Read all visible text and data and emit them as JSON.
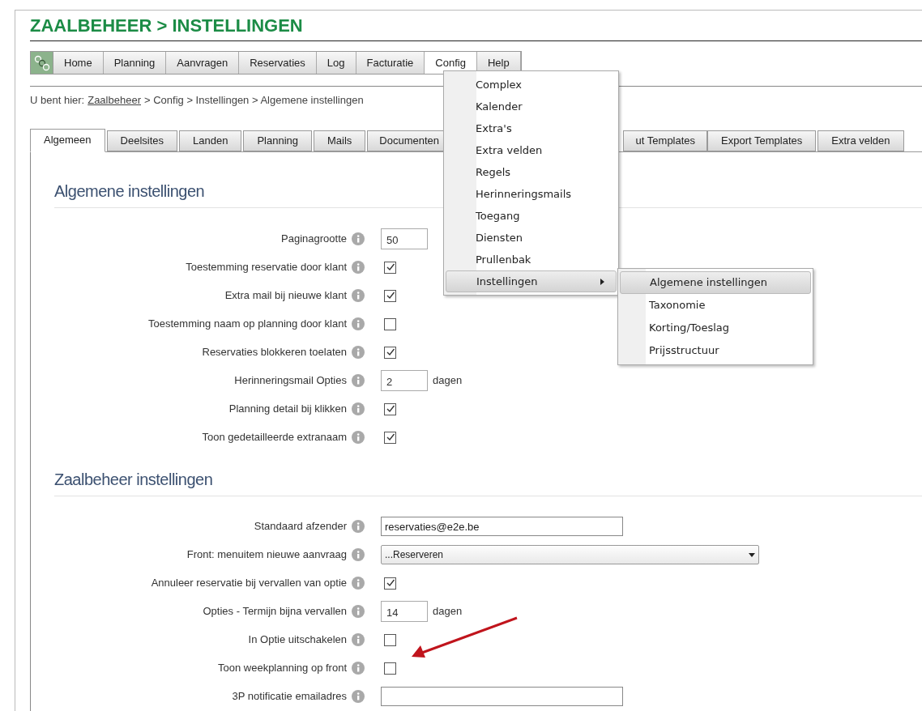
{
  "page_title": "ZAALBEHEER > INSTELLINGEN",
  "nav": {
    "items": [
      {
        "label": "Home",
        "selected": false
      },
      {
        "label": "Planning",
        "selected": false
      },
      {
        "label": "Aanvragen",
        "selected": false
      },
      {
        "label": "Reservaties",
        "selected": false
      },
      {
        "label": "Log",
        "selected": false
      },
      {
        "label": "Facturatie",
        "selected": false
      },
      {
        "label": "Config",
        "selected": true
      },
      {
        "label": "Help",
        "selected": false
      }
    ]
  },
  "breadcrumb": {
    "prefix": "U bent hier:",
    "link": "Zaalbeheer",
    "rest": "> Config > Instellingen > Algemene instellingen"
  },
  "tabs": [
    {
      "label": "Algemeen",
      "selected": true
    },
    {
      "label": "Deelsites",
      "selected": false
    },
    {
      "label": "Landen",
      "selected": false
    },
    {
      "label": "Planning",
      "selected": false
    },
    {
      "label": "Mails",
      "selected": false
    },
    {
      "label": "Documenten",
      "selected": false
    },
    {
      "label": "ut Templates",
      "selected": false
    },
    {
      "label": "Export Templates",
      "selected": false
    },
    {
      "label": "Extra velden",
      "selected": false
    }
  ],
  "sections": [
    {
      "title": "Algemene instellingen",
      "rows": [
        {
          "label": "Paginagrootte",
          "kind": "short",
          "value": "50"
        },
        {
          "label": "Toestemming reservatie door klant",
          "kind": "checkbox",
          "checked": true
        },
        {
          "label": "Extra mail bij nieuwe klant",
          "kind": "checkbox",
          "checked": true
        },
        {
          "label": "Toestemming naam op planning door klant",
          "kind": "checkbox",
          "checked": false
        },
        {
          "label": "Reservaties blokkeren toelaten",
          "kind": "checkbox",
          "checked": true
        },
        {
          "label": "Herinneringsmail Opties",
          "kind": "short",
          "value": "2",
          "unit": "dagen"
        },
        {
          "label": "Planning detail bij klikken",
          "kind": "checkbox",
          "checked": true
        },
        {
          "label": "Toon gedetailleerde extranaam",
          "kind": "checkbox",
          "checked": true
        }
      ]
    },
    {
      "title": "Zaalbeheer instellingen",
      "rows": [
        {
          "label": "Standaard afzender",
          "kind": "wide",
          "value": "reservaties@e2e.be"
        },
        {
          "label": "Front: menuitem nieuwe aanvraag",
          "kind": "select",
          "value": "...Reserveren"
        },
        {
          "label": "Annuleer reservatie bij vervallen van optie",
          "kind": "checkbox",
          "checked": true
        },
        {
          "label": "Opties - Termijn bijna vervallen",
          "kind": "short",
          "value": "14",
          "unit": "dagen"
        },
        {
          "label": "In Optie uitschakelen",
          "kind": "checkbox",
          "checked": false
        },
        {
          "label": "Toon weekplanning op front",
          "kind": "checkbox",
          "checked": false
        },
        {
          "label": "3P notificatie emailadres",
          "kind": "wide",
          "value": ""
        }
      ]
    }
  ],
  "config_menu": {
    "items": [
      {
        "label": "Complex",
        "kind": "item",
        "selected": false
      },
      {
        "label": "Kalender",
        "kind": "item",
        "selected": false
      },
      {
        "label": "Extra's",
        "kind": "item",
        "selected": false
      },
      {
        "label": "Extra velden",
        "kind": "item",
        "selected": false
      },
      {
        "label": "Regels",
        "kind": "item",
        "selected": false
      },
      {
        "label": "Herinneringsmails",
        "kind": "item",
        "selected": false
      },
      {
        "label": "Toegang",
        "kind": "item",
        "selected": false
      },
      {
        "label": "Diensten",
        "kind": "item",
        "selected": false
      },
      {
        "label": "Prullenbak",
        "kind": "item",
        "selected": false
      },
      {
        "label": "Instellingen",
        "kind": "submenu",
        "selected": true
      }
    ]
  },
  "submenu": {
    "items": [
      {
        "label": "Algemene instellingen",
        "selected": true
      },
      {
        "label": "Taxonomie",
        "selected": false
      },
      {
        "label": "Korting/Toeslag",
        "selected": false
      },
      {
        "label": "Prijsstructuur",
        "selected": false
      }
    ]
  }
}
